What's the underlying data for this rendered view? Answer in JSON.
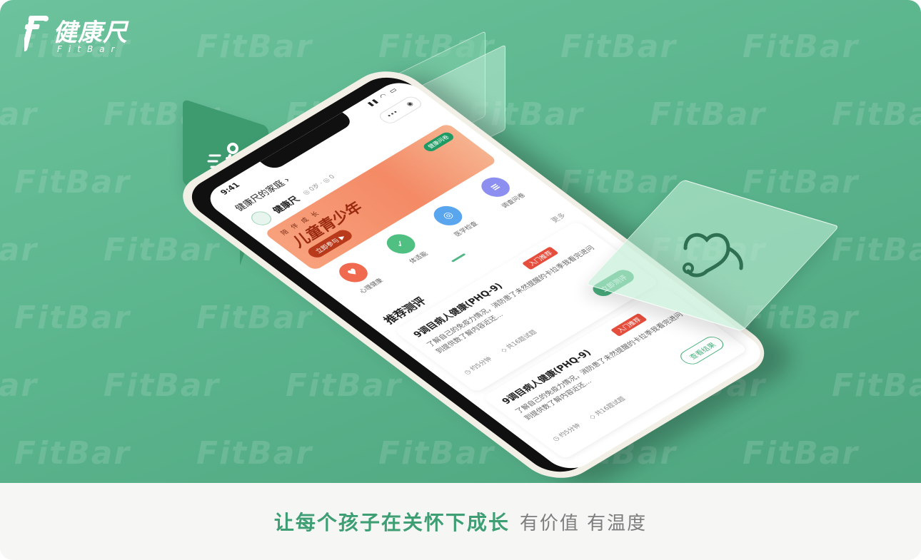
{
  "brand": {
    "name_cn": "健康尺",
    "name_en": "FitBar",
    "watermark": "FitBar",
    "primary_color": "#5bb58d",
    "accent_color": "#3f9f74"
  },
  "phone": {
    "status_time": "9:41",
    "status_icons": "signal-wifi-battery",
    "family_label": "健康尺的家庭 ›",
    "capsule": {
      "more": "•••",
      "close": "◉"
    },
    "profile": {
      "name": "健康尺",
      "meta": "◎ 0岁 · ◎ 0",
      "avatar_icon": "app-logo-icon"
    },
    "banner": {
      "subtitle": "陪伴成长",
      "title": "儿童青少年",
      "cta": "立即参与 ▶",
      "tag": "健康问卷"
    },
    "icons": [
      {
        "label": "心理健康",
        "color": "#f06a4f",
        "icon": "heart-icon",
        "glyph": "♥"
      },
      {
        "label": "体适能",
        "color": "#4fc081",
        "icon": "check-icon",
        "glyph": "✓"
      },
      {
        "label": "医学检查",
        "color": "#5aa6ee",
        "icon": "camera-icon",
        "glyph": "◎"
      },
      {
        "label": "调查问卷",
        "color": "#8c8ff0",
        "icon": "questionnaire-icon",
        "glyph": "≡"
      }
    ],
    "section": {
      "title": "推荐测评",
      "more": "更多"
    },
    "tests": [
      {
        "title": "9调目病人健康(PHQ-9)",
        "tag": "入门推荐",
        "desc": "了解自己的免疫力情况，消防患了未然提醒的卡拉季我看完进问到提供数了解内容近还...",
        "duration": "◷ 约5分钟",
        "count": "◇ 共16题试题",
        "button": "立即测评",
        "button_style": "primary"
      },
      {
        "title": "9调目病人健康(PHQ-9)",
        "tag": "入门推荐",
        "desc": "了解自己的免疫力情况，消防患了未然提醒的卡拉季我看完进问到提供数了解内容近还...",
        "duration": "◷ 约5分钟",
        "count": "◇ 共16题试题",
        "button": "查看结果",
        "button_style": "ghost"
      }
    ]
  },
  "decor": {
    "bubble_icon": "running-person-icon",
    "glass_icon": "graduation-cap-icon",
    "steth_icon": "stethoscope-icon"
  },
  "footer": {
    "slogan_main": "让每个孩子在关怀下成长",
    "slogan_sub": "有价值  有温度"
  }
}
